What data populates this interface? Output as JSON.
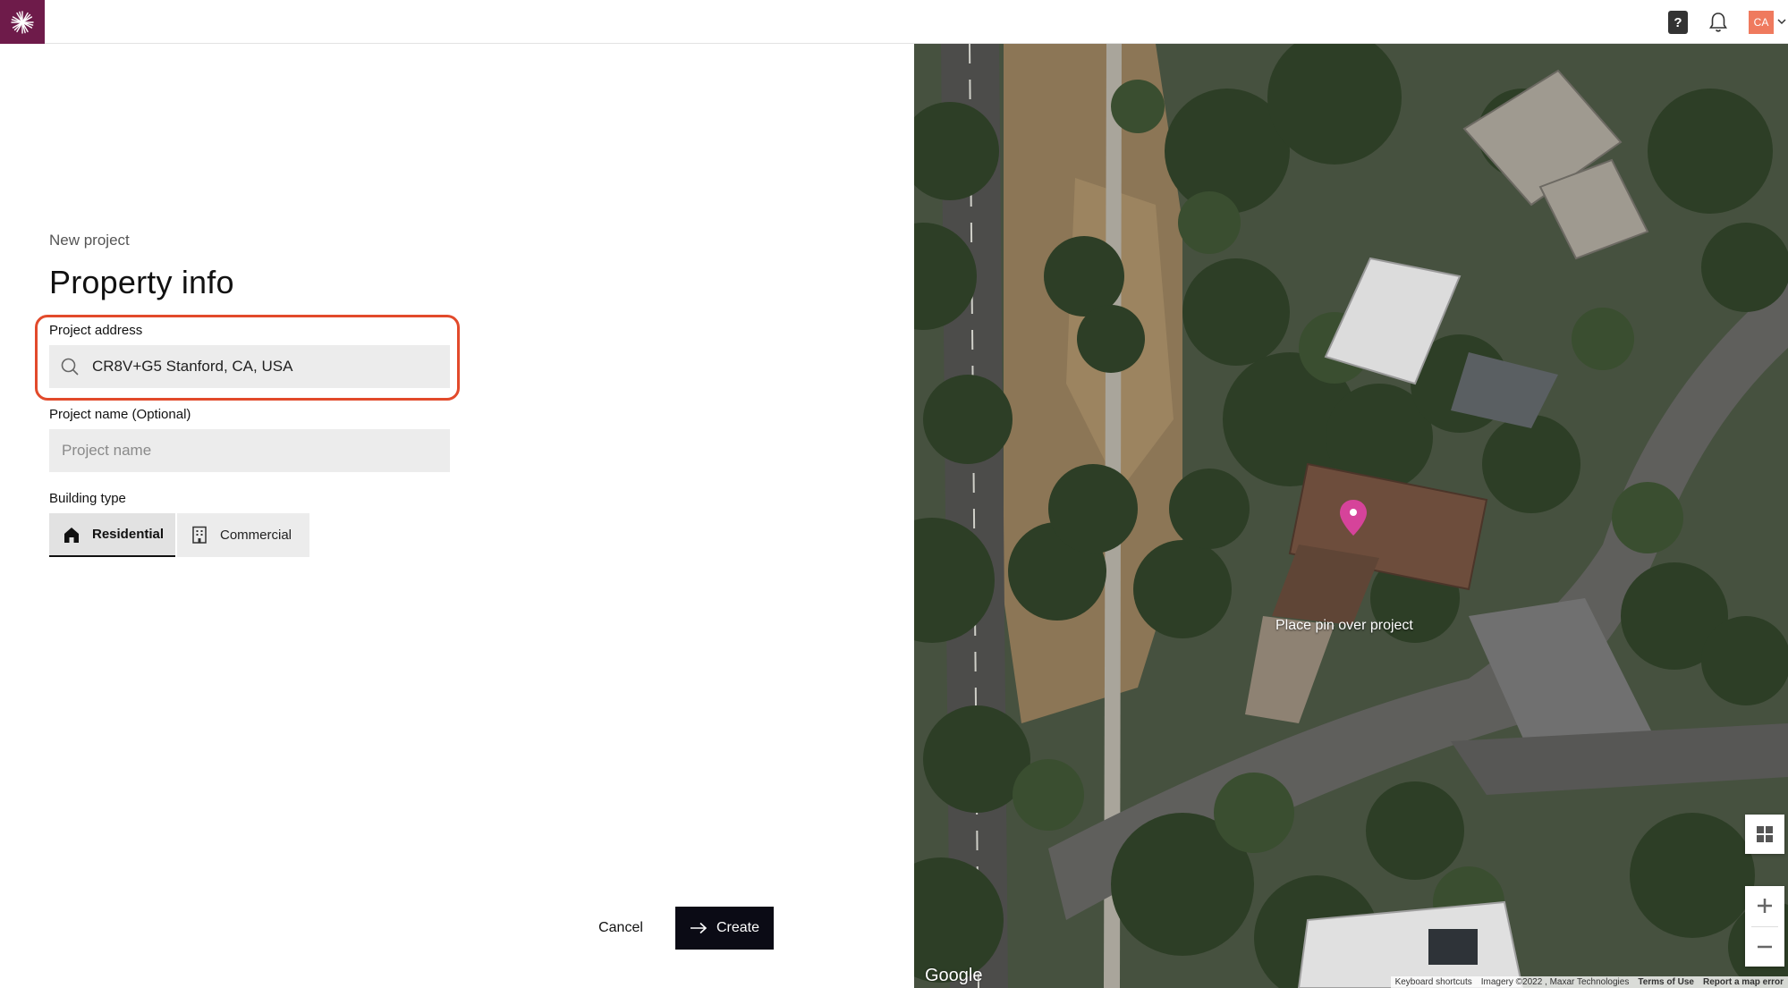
{
  "app": {
    "accent_color": "#6e1b4a",
    "highlight_color": "#e24a2b"
  },
  "header": {
    "help_label": "?",
    "avatar_initials": "CA"
  },
  "form": {
    "eyebrow": "New project",
    "title": "Property info",
    "address_label": "Project address",
    "address_value": "CR8V+G5 Stanford, CA, USA",
    "name_label": "Project name (Optional)",
    "name_placeholder": "Project name",
    "building_type_label": "Building type",
    "building_types": [
      {
        "label": "Residential",
        "selected": true,
        "icon": "house-icon"
      },
      {
        "label": "Commercial",
        "selected": false,
        "icon": "building-icon"
      }
    ],
    "cancel_label": "Cancel",
    "create_label": "Create"
  },
  "map": {
    "pin_hint": "Place pin over project",
    "pin_color": "#d6439a",
    "google_label": "Google",
    "attribution": {
      "keyboard": "Keyboard shortcuts",
      "imagery": "Imagery ©2022 , Maxar Technologies",
      "terms": "Terms of Use",
      "report": "Report a map error"
    }
  }
}
